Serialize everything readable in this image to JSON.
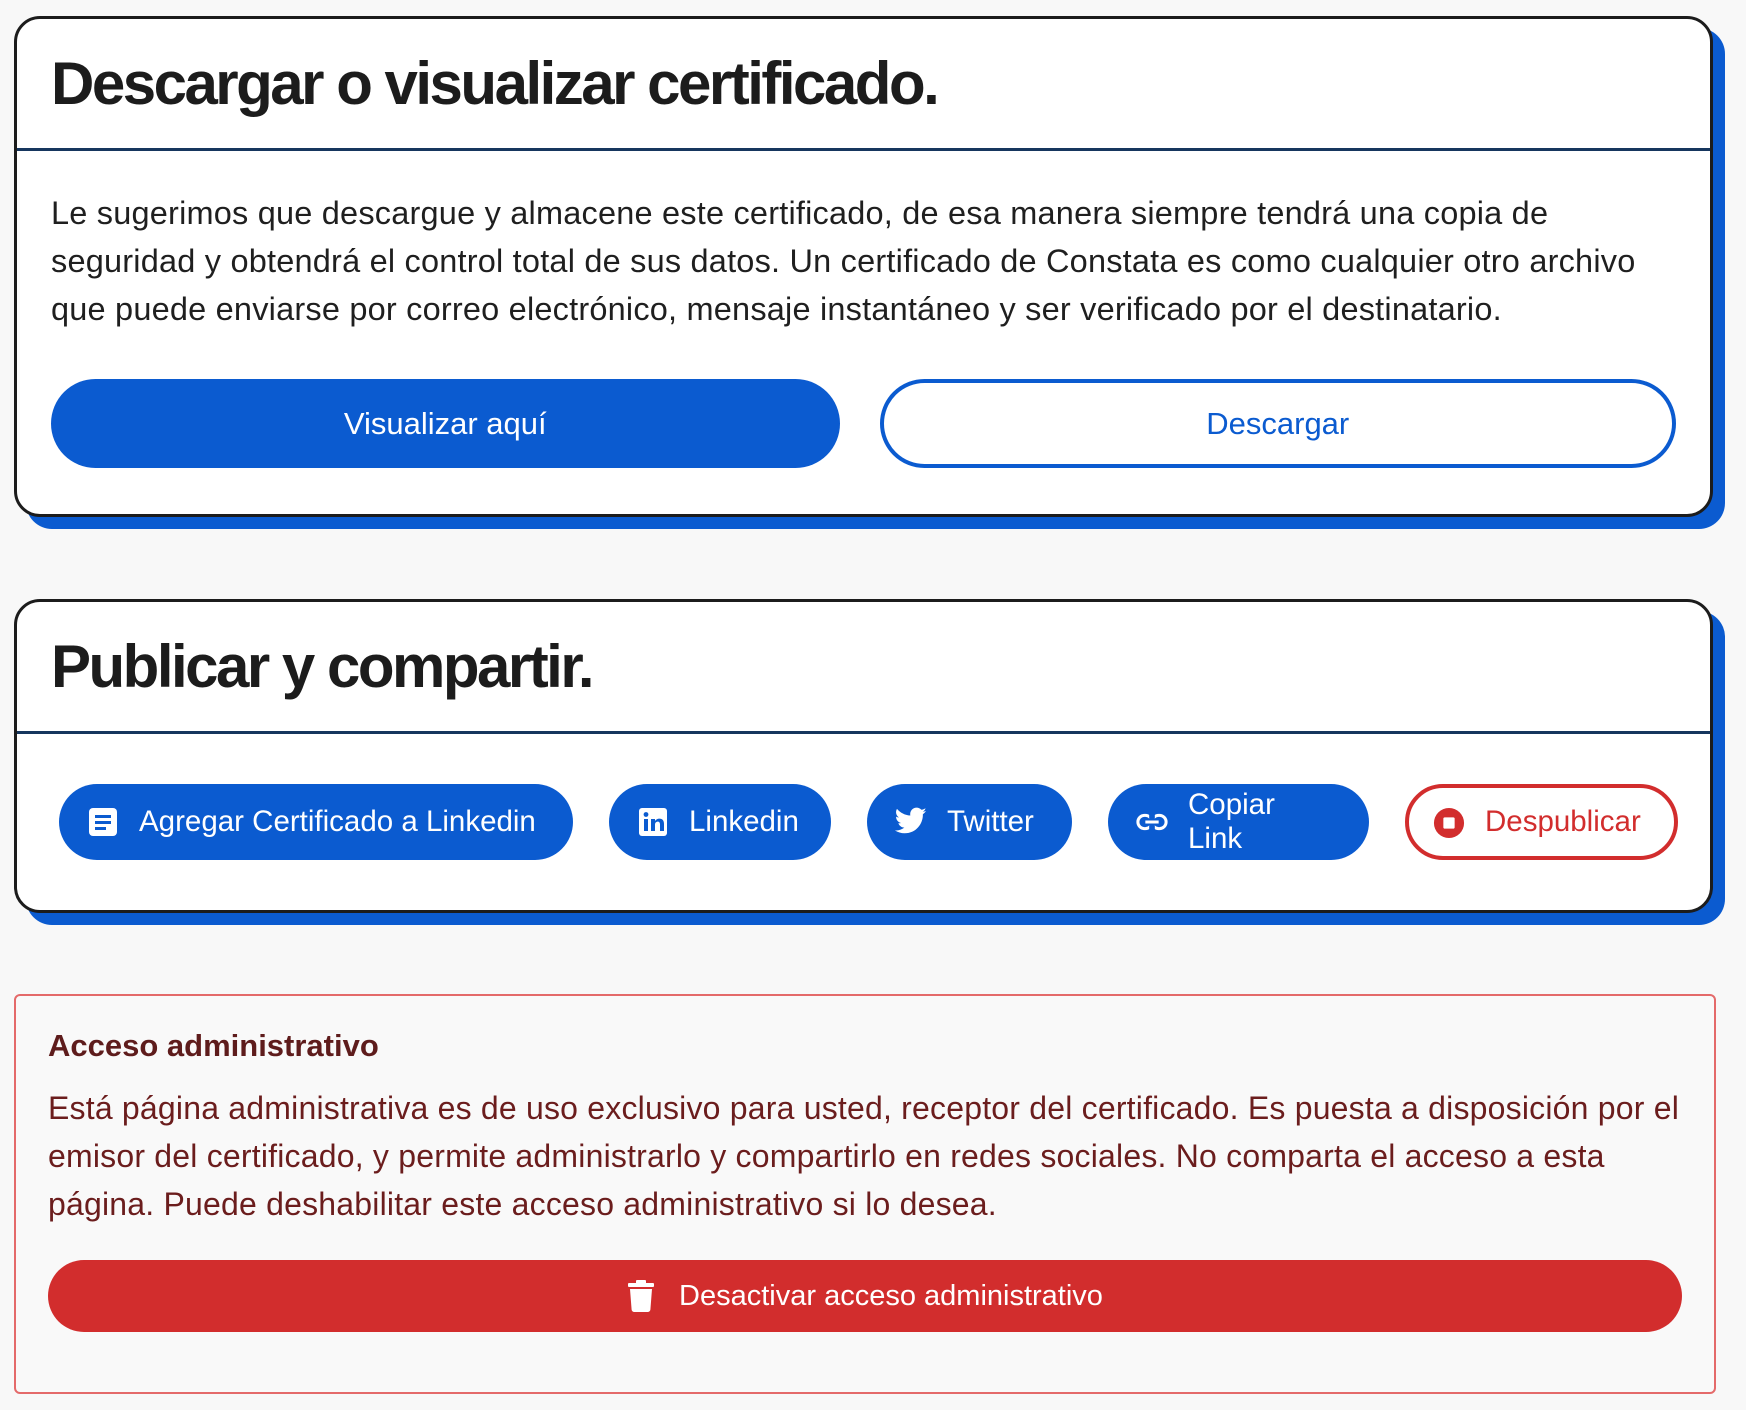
{
  "download_card": {
    "title": "Descargar o visualizar certificado.",
    "description": "Le sugerimos que descargue y almacene este certificado, de esa manera siempre tendrá una copia de seguridad y obtendrá el control total de sus datos. Un certificado de Constata es como cualquier otro archivo que puede enviarse por correo electrónico, mensaje instantáneo y ser verificado por el destinatario.",
    "view_label": "Visualizar aquí",
    "download_label": "Descargar"
  },
  "share_card": {
    "title": "Publicar y compartir.",
    "buttons": [
      {
        "label": "Agregar Certificado a Linkedin",
        "icon": "document-icon"
      },
      {
        "label": "Linkedin",
        "icon": "linkedin-icon"
      },
      {
        "label": "Twitter",
        "icon": "twitter-icon"
      },
      {
        "label": "Copiar Link",
        "icon": "link-icon"
      },
      {
        "label": "Despublicar",
        "icon": "stop-icon"
      }
    ]
  },
  "admin": {
    "title": "Acceso administrativo",
    "text": "Está página administrativa es de uso exclusivo para usted, receptor del certificado. Es puesta a disposición por el emisor del certificado, y permite administrarlo y compartirlo en redes sociales. No comparta el acceso a esta página. Puede deshabilitar este acceso administrativo si lo desea.",
    "button_label": "Desactivar acceso administrativo",
    "button_icon": "trash-icon"
  },
  "colors": {
    "primary": "#0b5bd0",
    "danger": "#d22d2d",
    "admin_text": "#6b1d1d"
  }
}
